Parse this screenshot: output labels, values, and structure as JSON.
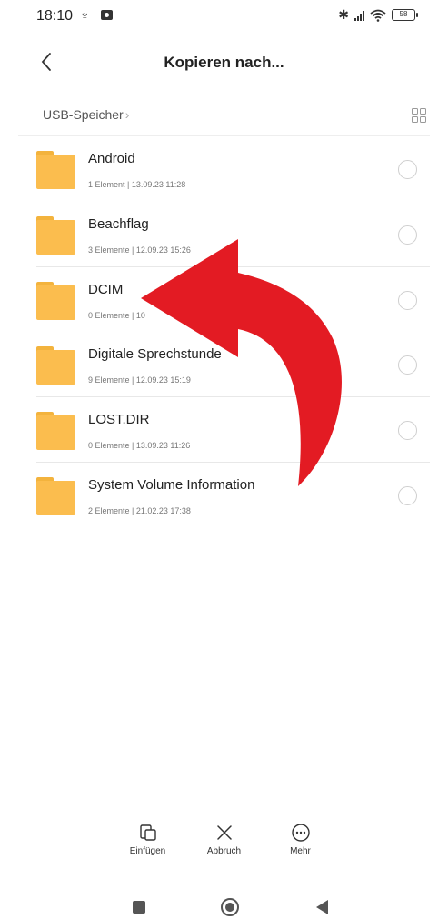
{
  "status_bar": {
    "time": "18:10",
    "usb_glyph": "♆",
    "bluetooth_glyph": "✱",
    "battery_level": "58"
  },
  "header": {
    "title": "Kopieren nach..."
  },
  "breadcrumb": {
    "label": "USB-Speicher",
    "chevron": "›"
  },
  "files": [
    {
      "name": "Android",
      "meta": "1 Element  |  13.09.23 11:28"
    },
    {
      "name": "Beachflag",
      "meta": "3 Elemente  |  12.09.23 15:26"
    },
    {
      "name": "DCIM",
      "meta": "0 Elemente  |  10"
    },
    {
      "name": "Digitale Sprechstunde",
      "meta": "9 Elemente  |  12.09.23 15:19"
    },
    {
      "name": "LOST.DIR",
      "meta": "0 Elemente  |  13.09.23 11:26"
    },
    {
      "name": "System Volume Information",
      "meta": "2 Elemente  |  21.02.23 17:38"
    }
  ],
  "toolbar": {
    "paste_label": "Einfügen",
    "cancel_label": "Abbruch",
    "more_label": "Mehr"
  },
  "colors": {
    "folder": "#fbbd4e",
    "annotation_arrow": "#e31b23"
  },
  "icons": {
    "back": "chevron-left-icon",
    "view_toggle": "grid-view-icon",
    "paste": "paste-icon",
    "cancel": "close-icon",
    "more": "more-icon",
    "nav_recents": "square-icon",
    "nav_home": "home-circle-icon",
    "nav_back": "triangle-back-icon"
  }
}
